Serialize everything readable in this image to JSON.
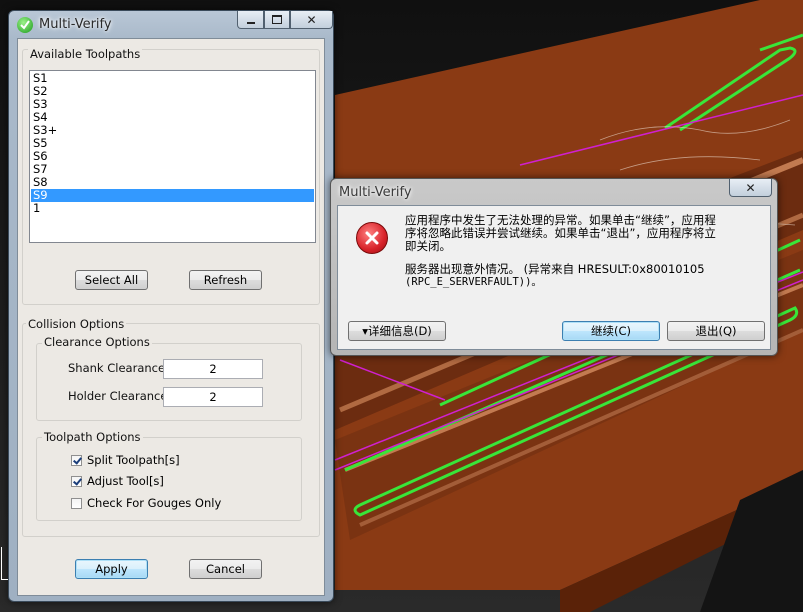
{
  "main_window": {
    "title": "Multi-Verify",
    "caption": {
      "minimize": "▭",
      "maximize": "□",
      "close": "✕"
    },
    "available_toolpaths": {
      "label": "Available Toolpaths",
      "items": [
        "S1",
        "S2",
        "S3",
        "S4",
        "S3+",
        "S5",
        "S6",
        "S7",
        "S8",
        "S9",
        "1"
      ],
      "selected_index": 9,
      "select_all_label": "Select All",
      "refresh_label": "Refresh"
    },
    "collision_options": {
      "label": "Collision Options",
      "clearance_options": {
        "label": "Clearance Options",
        "shank_label": "Shank Clearance",
        "shank_value": "2",
        "holder_label": "Holder Clearance",
        "holder_value": "2"
      },
      "toolpath_options": {
        "label": "Toolpath Options",
        "split_label": "Split Toolpath[s]",
        "split_checked": true,
        "adjust_label": "Adjust Tool[s]",
        "adjust_checked": true,
        "gouges_label": "Check For Gouges Only",
        "gouges_checked": false
      }
    },
    "apply_label": "Apply",
    "cancel_label": "Cancel"
  },
  "error_dialog": {
    "title": "Multi-Verify",
    "close": "✕",
    "message_line1": "应用程序中发生了无法处理的异常。如果单击“继续”，应用程",
    "message_line2": "序将忽略此错误并尝试继续。如果单击“退出”，应用程序将立",
    "message_line3": "即关闭。",
    "detail_line1": "服务器出现意外情况。 (异常来自 HRESULT:0x80010105",
    "detail_line2": "(RPC_E_SERVERFAULT))。",
    "details_label": "▾详细信息(D)",
    "continue_label": "继续(C)",
    "quit_label": "退出(Q)"
  },
  "colors": {
    "part_surface": "#8a3a14",
    "toolpath_green": "#39e639",
    "toolpath_magenta": "#d020d0",
    "selection": "#3399ff",
    "error_red": "#d8232a"
  }
}
